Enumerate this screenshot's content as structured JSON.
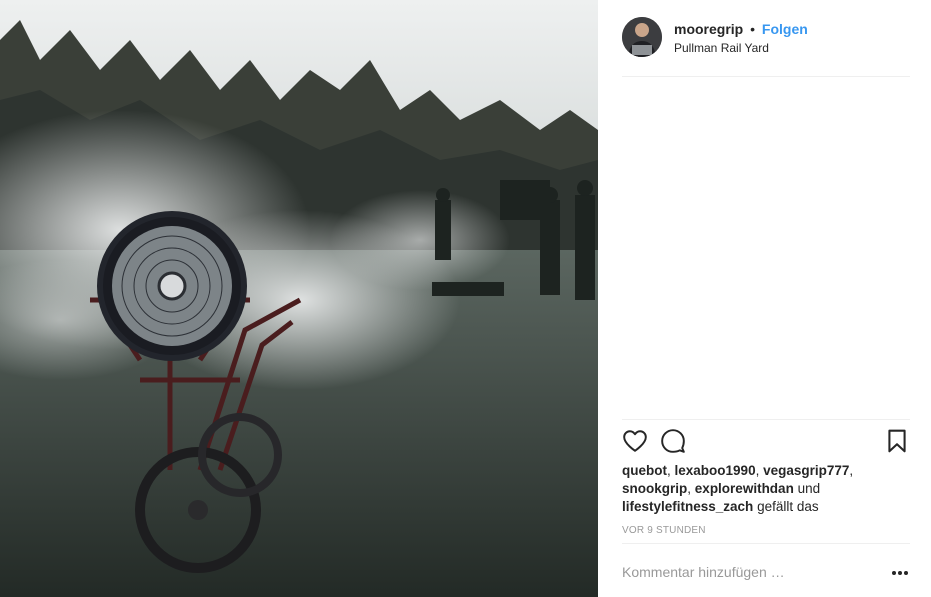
{
  "post": {
    "username": "mooregrip",
    "separator": "•",
    "follow_label": "Folgen",
    "location": "Pullman Rail Yard"
  },
  "likes": {
    "user1": "quebot",
    "sep1": ",",
    "user2": "lexaboo1990",
    "sep2": ",",
    "user3": "vegasgrip777",
    "sep3": ",",
    "user4": "snookgrip",
    "sep4": ",",
    "user5": "explorewithdan",
    "and": "und",
    "user6": "lifestylefitness_zach",
    "suffix": "gefällt das"
  },
  "timestamp": "VOR 9 STUNDEN",
  "comment": {
    "placeholder": "Kommentar hinzufügen …"
  },
  "icons": {
    "like": "heart-icon",
    "comment": "comment-icon",
    "save": "bookmark-icon",
    "more": "more-options-icon"
  }
}
